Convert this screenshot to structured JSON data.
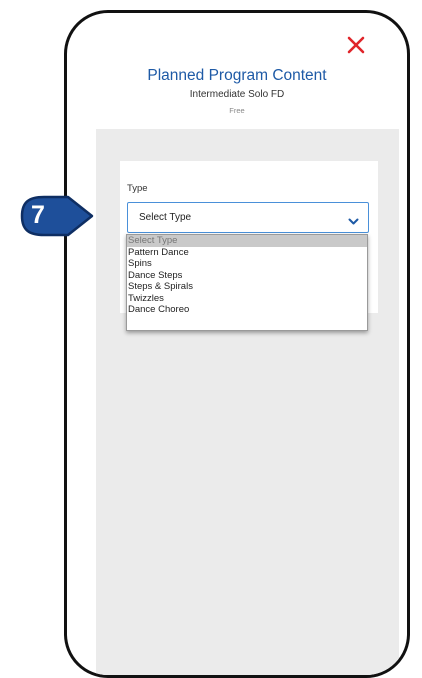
{
  "step": {
    "number": "7"
  },
  "modal": {
    "title": "Planned Program Content",
    "subtitle": "Intermediate Solo FD",
    "tier": "Free"
  },
  "form": {
    "type_label": "Type",
    "type_select_value": "Select Type",
    "options": [
      "Select Type",
      "Pattern Dance",
      "Spins",
      "Dance Steps",
      "Steps & Spirals",
      "Twizzles",
      "Dance Choreo"
    ],
    "selected_index": 0
  },
  "colors": {
    "accent_blue": "#1e5aa6",
    "close_red": "#e0252a",
    "badge_blue": "#1e4f9a",
    "select_border": "#4a90d9"
  },
  "icons": {
    "close": "x-icon",
    "chevron": "chevron-down-icon",
    "step_badge": "arrow-badge-icon"
  }
}
